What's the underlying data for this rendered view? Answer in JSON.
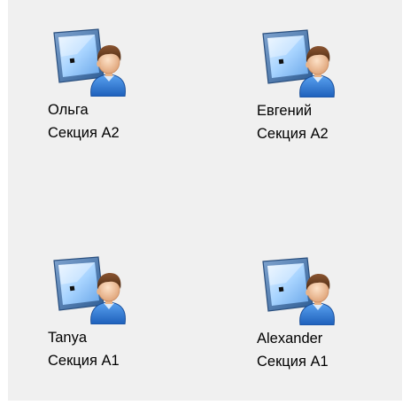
{
  "users": [
    {
      "name": "Ольга",
      "section": "Секция А2",
      "icon": "user-computer-icon"
    },
    {
      "name": "Евгений",
      "section": "Секция А2",
      "icon": "user-computer-icon"
    },
    {
      "name": "Tanya",
      "section": "Секция А1",
      "icon": "user-computer-icon"
    },
    {
      "name": "Alexander",
      "section": "Секция А1",
      "icon": "user-computer-icon"
    }
  ],
  "colors": {
    "panel_background": "#f0f0f0",
    "text": "#000000",
    "monitor_frame": "#3c6ea8",
    "monitor_screen": "#a8d4ff",
    "shirt": "#2f78d8",
    "hair": "#6b3f1f",
    "skin": "#f3c9a2"
  }
}
